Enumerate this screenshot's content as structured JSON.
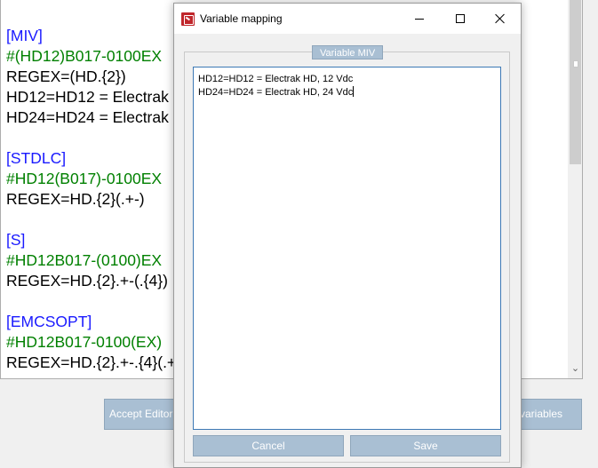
{
  "editor": {
    "lines": [
      {
        "text": "[MIV]",
        "kind": "section"
      },
      {
        "text": "#(HD12)B017-0100EX",
        "kind": "comment"
      },
      {
        "text": "REGEX=(HD.{2})",
        "kind": "text"
      },
      {
        "text": "HD12=HD12 = Electrak HD, 12 Vdc",
        "kind": "text"
      },
      {
        "text": "HD24=HD24 = Electrak HD, 24 Vdc",
        "kind": "text"
      },
      {
        "text": "",
        "kind": "text"
      },
      {
        "text": "[STDLC]",
        "kind": "section"
      },
      {
        "text": "#HD12(B017)-0100EX",
        "kind": "comment"
      },
      {
        "text": "REGEX=HD.{2}(.+-)",
        "kind": "text"
      },
      {
        "text": "",
        "kind": "text"
      },
      {
        "text": "[S]",
        "kind": "section"
      },
      {
        "text": "#HD12B017-(0100)EX",
        "kind": "comment"
      },
      {
        "text": "REGEX=HD.{2}.+-(.{4})",
        "kind": "text"
      },
      {
        "text": "",
        "kind": "text"
      },
      {
        "text": "[EMCSOPT]",
        "kind": "section"
      },
      {
        "text": "#HD12B017-0100(EX)",
        "kind": "comment"
      },
      {
        "text": "REGEX=HD.{2}.+-.{4}(.+)",
        "kind": "text"
      }
    ],
    "scroll_down_glyph": "⌄"
  },
  "background_buttons": {
    "accept": "Accept Editor",
    "variables": "variables"
  },
  "dialog": {
    "title": "Variable mapping",
    "group_label": "Variable MIV",
    "text_lines": [
      "HD12=HD12 = Electrak HD, 12 Vdc",
      "HD24=HD24 = Electrak HD, 24 Vdc"
    ],
    "cancel_label": "Cancel",
    "save_label": "Save"
  },
  "colors": {
    "section": "#1a1aff",
    "comment": "#008000",
    "button_fill": "#a9bfd3",
    "textarea_border": "#3d79b5"
  }
}
